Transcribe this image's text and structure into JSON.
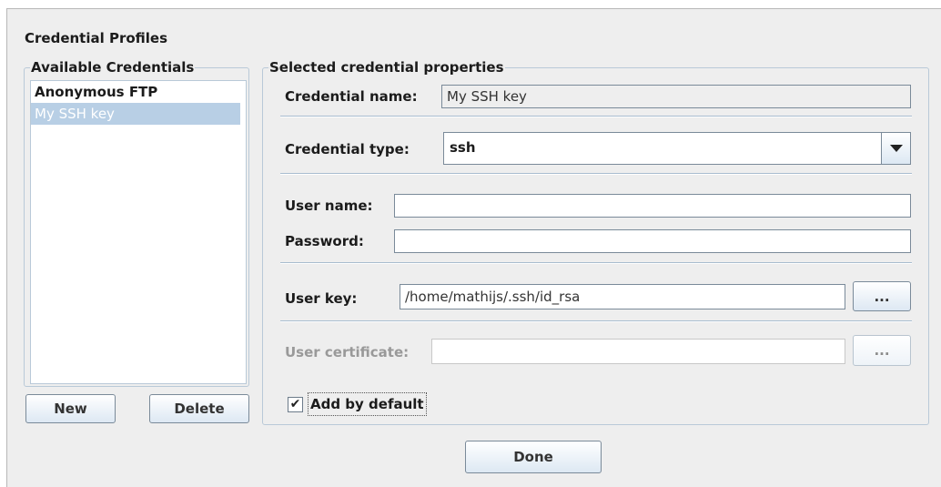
{
  "dialog": {
    "title": "Credential Profiles"
  },
  "available": {
    "legend": "Available Credentials",
    "items": [
      {
        "label": "Anonymous FTP",
        "selected": false
      },
      {
        "label": "My SSH key",
        "selected": true
      }
    ],
    "new_label": "New",
    "delete_label": "Delete"
  },
  "properties": {
    "legend": "Selected credential properties",
    "credential_name": {
      "label": "Credential name:",
      "value": "My SSH key"
    },
    "credential_type": {
      "label": "Credential type:",
      "value": "ssh"
    },
    "user_name": {
      "label": "User name:",
      "value": ""
    },
    "password": {
      "label": "Password:",
      "value": ""
    },
    "user_key": {
      "label": "User key:",
      "value": "/home/mathijs/.ssh/id_rsa",
      "browse_label": "..."
    },
    "user_certificate": {
      "label": "User certificate:",
      "value": "",
      "browse_label": "...",
      "enabled": false
    },
    "add_by_default": {
      "label": "Add by default",
      "checked": true,
      "check_glyph": "✔"
    }
  },
  "footer": {
    "done_label": "Done"
  },
  "colors": {
    "selection": "#b8cfe5",
    "group_border": "#b9c9d8",
    "background": "#eeeeee"
  }
}
